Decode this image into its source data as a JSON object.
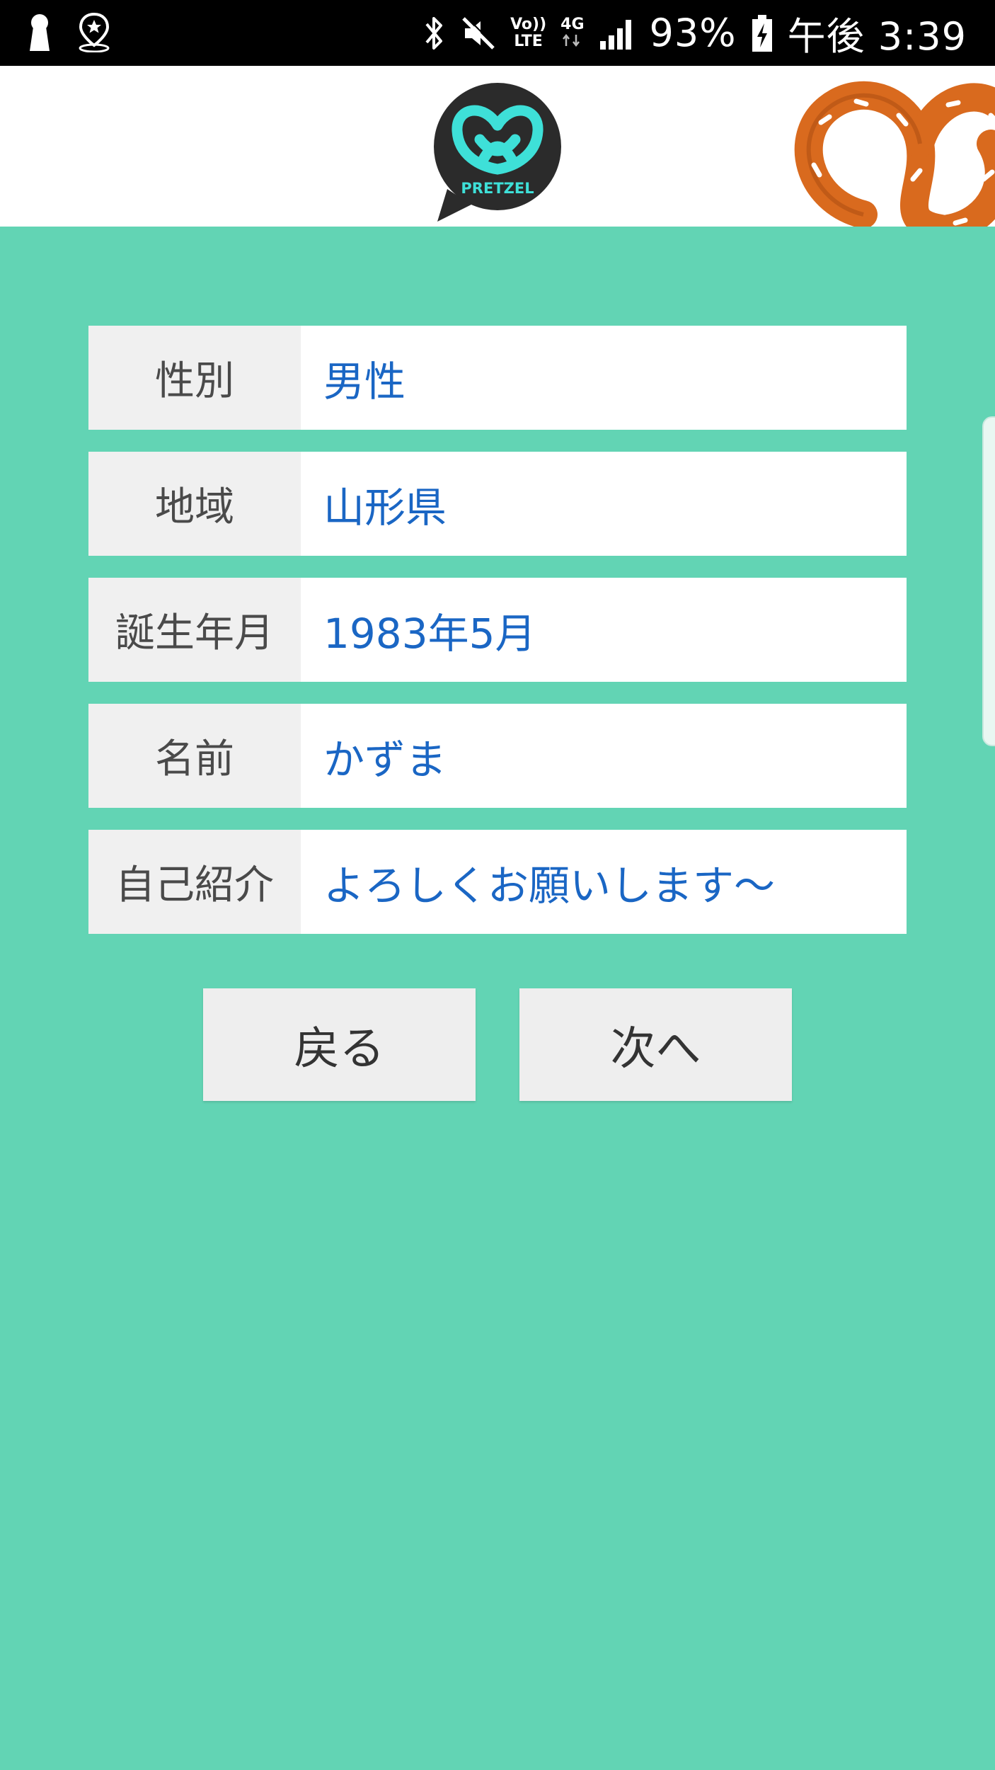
{
  "status_bar": {
    "battery": "93%",
    "time": "午後 3:39",
    "lte_top": "Vo))",
    "lte_bottom": "LTE",
    "network_type": "4G"
  },
  "header": {
    "logo_text": "PRETZEL",
    "logo_bg_color": "#2b2b2b",
    "logo_accent_color": "#3ee0d8"
  },
  "form": {
    "rows": [
      {
        "label": "性別",
        "value": "男性"
      },
      {
        "label": "地域",
        "value": "山形県"
      },
      {
        "label": "誕生年月",
        "value": "1983年5月"
      },
      {
        "label": "名前",
        "value": "かずま"
      },
      {
        "label": "自己紹介",
        "value": "よろしくお願いします〜"
      }
    ]
  },
  "buttons": {
    "back_label": "戻る",
    "next_label": "次へ"
  },
  "colors": {
    "background": "#62d4b4",
    "value_text": "#1a66c4",
    "label_text": "#4a4a4a",
    "pretzel": "#d96a1e"
  }
}
